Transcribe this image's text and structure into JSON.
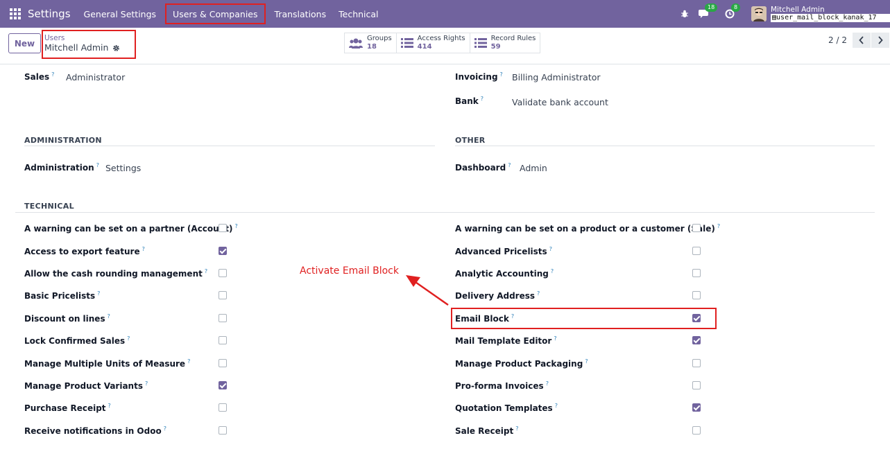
{
  "navbar": {
    "brand": "Settings",
    "items": [
      "General Settings",
      "Users & Companies",
      "Translations",
      "Technical"
    ],
    "messages_count": "18",
    "activities_count": "8",
    "user_name": "Mitchell Admin",
    "database": "user_mail_block_kanak_17"
  },
  "control": {
    "new_label": "New",
    "breadcrumb_parent": "Users",
    "breadcrumb_current": "Mitchell Admin",
    "stats": [
      {
        "label": "Groups",
        "value": "18",
        "icon": "users-icon"
      },
      {
        "label": "Access Rights",
        "value": "414",
        "icon": "list-icon"
      },
      {
        "label": "Record Rules",
        "value": "59",
        "icon": "list-icon"
      }
    ],
    "pager": "2 / 2"
  },
  "fields": {
    "sales": {
      "label": "Sales",
      "value": "Administrator"
    },
    "invoicing": {
      "label": "Invoicing",
      "value": "Billing Administrator"
    },
    "bank": {
      "label": "Bank",
      "value": "Validate bank account"
    },
    "administration": {
      "label": "Administration",
      "value": "Settings"
    },
    "dashboard": {
      "label": "Dashboard",
      "value": "Admin"
    }
  },
  "sections": {
    "administration": "ADMINISTRATION",
    "other": "OTHER",
    "technical": "TECHNICAL"
  },
  "help_mark": "?",
  "technical_left": [
    {
      "label": "A warning can be set on a partner (Account)",
      "checked": false
    },
    {
      "label": "Access to export feature",
      "checked": true
    },
    {
      "label": "Allow the cash rounding management",
      "checked": false
    },
    {
      "label": "Basic Pricelists",
      "checked": false
    },
    {
      "label": "Discount on lines",
      "checked": false
    },
    {
      "label": "Lock Confirmed Sales",
      "checked": false
    },
    {
      "label": "Manage Multiple Units of Measure",
      "checked": false
    },
    {
      "label": "Manage Product Variants",
      "checked": true
    },
    {
      "label": "Purchase Receipt",
      "checked": false
    },
    {
      "label": "Receive notifications in Odoo",
      "checked": false
    }
  ],
  "technical_right": [
    {
      "label": "A warning can be set on a product or a customer (Sale)",
      "checked": false
    },
    {
      "label": "Advanced Pricelists",
      "checked": false
    },
    {
      "label": "Analytic Accounting",
      "checked": false
    },
    {
      "label": "Delivery Address",
      "checked": false
    },
    {
      "label": "Email Block",
      "checked": true
    },
    {
      "label": "Mail Template Editor",
      "checked": true
    },
    {
      "label": "Manage Product Packaging",
      "checked": false
    },
    {
      "label": "Pro-forma Invoices",
      "checked": false
    },
    {
      "label": "Quotation Templates",
      "checked": true
    },
    {
      "label": "Sale Receipt",
      "checked": false
    }
  ],
  "annotation": "Activate Email Block",
  "colors": {
    "brand": "#71639e",
    "highlight": "#e02020",
    "badge": "#28a745"
  }
}
